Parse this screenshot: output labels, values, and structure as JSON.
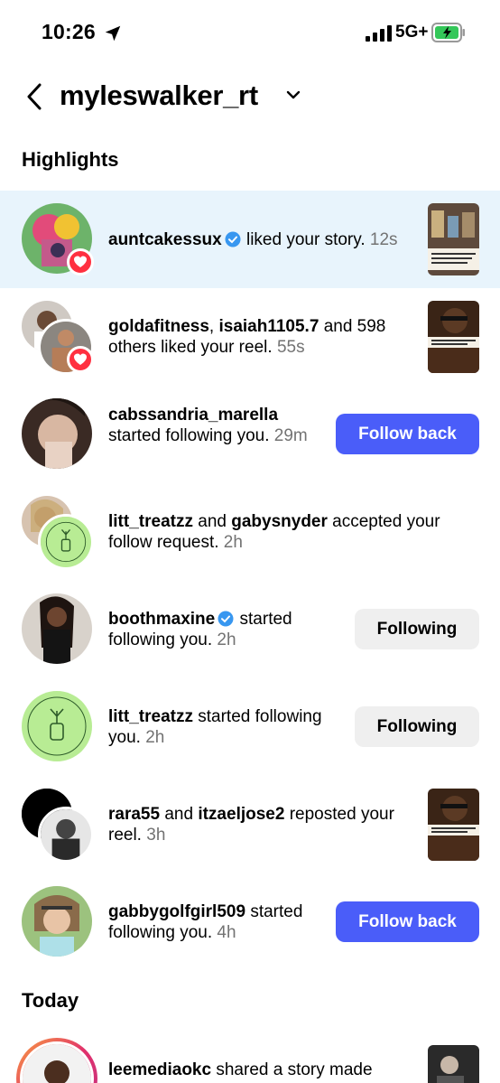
{
  "status": {
    "time": "10:26",
    "network": "5G+"
  },
  "header": {
    "title": "myleswalker_rt"
  },
  "sections": {
    "highlights": "Highlights",
    "today": "Today"
  },
  "rows": [
    {
      "parts": [
        "auntcakessux",
        "liked your story.",
        "12s"
      ]
    },
    {
      "parts": [
        "goldafitness",
        ",",
        "isaiah1105.7",
        "and 598 others liked your reel.",
        "55s"
      ]
    },
    {
      "parts": [
        "cabssandria_marella",
        "started following you.",
        "29m"
      ],
      "button": "Follow back"
    },
    {
      "parts": [
        "litt_treatzz",
        "and",
        "gabysnyder",
        "accepted your follow request.",
        "2h"
      ]
    },
    {
      "parts": [
        "boothmaxine",
        "started following you.",
        "2h"
      ],
      "button": "Following"
    },
    {
      "parts": [
        "litt_treatzz",
        "started following you.",
        "2h"
      ],
      "button": "Following"
    },
    {
      "parts": [
        "rara55",
        "and",
        "itzaeljose2",
        "reposted your reel.",
        "3h"
      ]
    },
    {
      "parts": [
        "gabbygolfgirl509",
        "started following you.",
        "4h"
      ],
      "button": "Follow back"
    },
    {
      "parts": [
        "leemediaokc",
        "shared a story made"
      ]
    }
  ],
  "colors": {
    "accent": "#4a5df9",
    "highlight_bg": "#e8f4fc",
    "heart": "#ff3040",
    "verified": "#3897f0",
    "time": "#737373"
  },
  "icons": [
    "location-arrow-icon",
    "signal-icon",
    "battery-icon",
    "back-chevron-icon",
    "chevron-down-icon",
    "verified-badge-icon",
    "heart-badge-icon"
  ]
}
